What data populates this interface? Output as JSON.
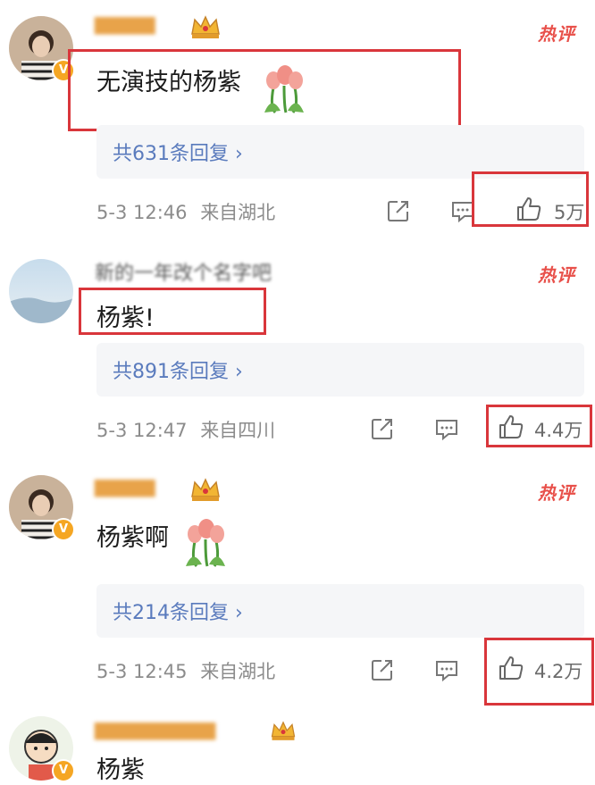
{
  "comments": [
    {
      "text": "无演技的杨紫",
      "hot_badge": "热评",
      "replies": "共631条回复 ›",
      "time": "5-3 12:46",
      "location": "来自湖北",
      "likes": "5万"
    },
    {
      "username": "新的一年改个名字吧",
      "text": "杨紫!",
      "hot_badge": "热评",
      "replies": "共891条回复 ›",
      "time": "5-3 12:47",
      "location": "来自四川",
      "likes": "4.4万"
    },
    {
      "text": "杨紫啊",
      "hot_badge": "热评",
      "replies": "共214条回复 ›",
      "time": "5-3 12:45",
      "location": "来自湖北",
      "likes": "4.2万"
    },
    {
      "text": "杨紫"
    }
  ],
  "icons": {
    "verified": "v-badge-icon",
    "share": "share-icon",
    "comment": "comment-icon",
    "like": "thumbs-up-icon",
    "crown": "crown-icon",
    "flower": "tulip-emoji-icon"
  },
  "colors": {
    "highlight_box": "#d9363b",
    "reply_link": "#5a7bbd",
    "hot_badge": "#e8504a",
    "verified": "#f5a623"
  }
}
